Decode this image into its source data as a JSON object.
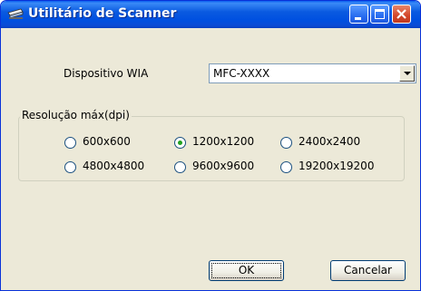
{
  "window": {
    "title": "Utilitário de Scanner"
  },
  "device": {
    "label": "Dispositivo WIA",
    "selected": "MFC-XXXX"
  },
  "resolution": {
    "group_label": "Resolução máx(dpi)",
    "options": [
      {
        "label": "600x600",
        "checked": false
      },
      {
        "label": "1200x1200",
        "checked": true
      },
      {
        "label": "2400x2400",
        "checked": false
      },
      {
        "label": "4800x4800",
        "checked": false
      },
      {
        "label": "9600x9600",
        "checked": false
      },
      {
        "label": "19200x19200",
        "checked": false
      }
    ]
  },
  "buttons": {
    "ok": "OK",
    "cancel": "Cancelar"
  },
  "colors": {
    "titlebar": "#0a5ae0",
    "dialog_bg": "#ece9d8",
    "close_button": "#d2462a"
  }
}
